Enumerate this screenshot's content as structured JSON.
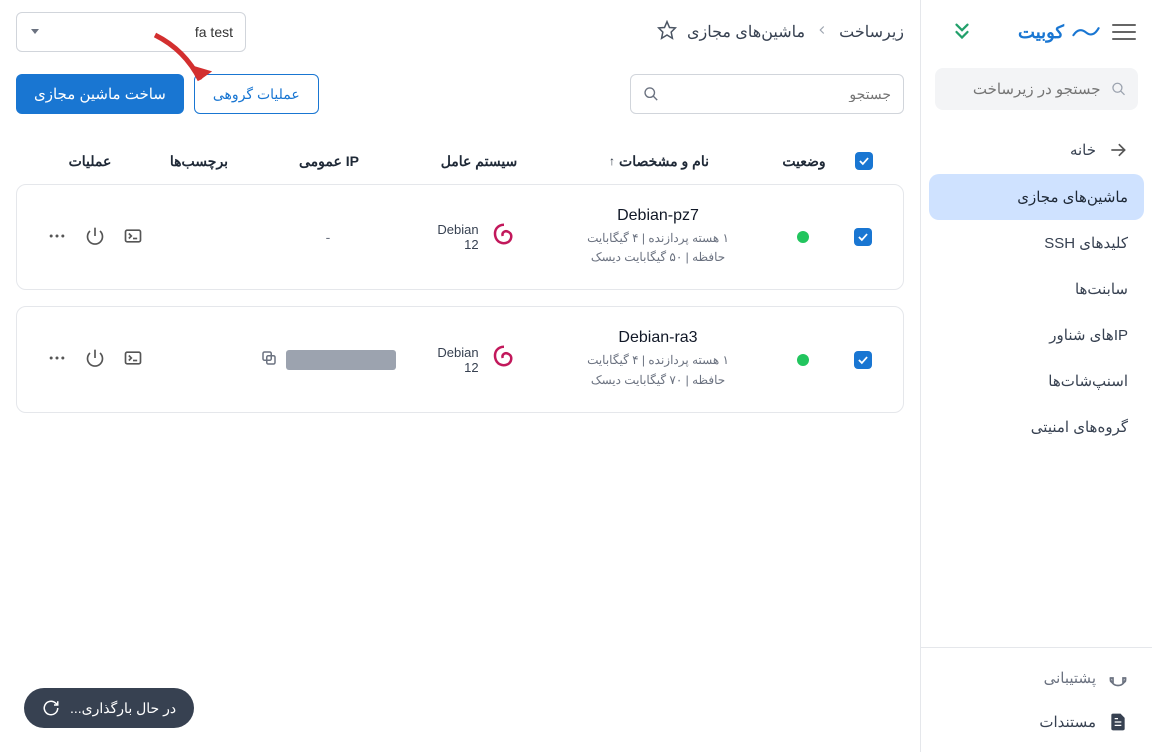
{
  "brand": {
    "name": "کوبیت"
  },
  "sidebar": {
    "search_placeholder": "جستجو در زیرساخت",
    "items": [
      {
        "label": "خانه",
        "icon": "arrow"
      },
      {
        "label": "ماشین‌های مجازی",
        "active": true
      },
      {
        "label": "کلیدهای SSH"
      },
      {
        "label": "سابنت‌ها"
      },
      {
        "label": "IPهای شناور"
      },
      {
        "label": "اسنپ‌شات‌ها"
      },
      {
        "label": "گروه‌های امنیتی"
      }
    ],
    "footer": [
      {
        "label": "پشتیبانی",
        "icon": "support"
      },
      {
        "label": "مستندات",
        "icon": "doc",
        "dark": true
      }
    ]
  },
  "breadcrumb": {
    "root": "زیرساخت",
    "current": "ماشین‌های مجازی"
  },
  "project": {
    "selected": "fa test"
  },
  "toolbar": {
    "search_placeholder": "جستجو",
    "group_ops": "عملیات گروهی",
    "create_vm": "ساخت ماشین مجازی"
  },
  "table": {
    "headers": {
      "status": "وضعیت",
      "name": "نام و مشخصات",
      "os": "سیستم عامل",
      "ip": "IP عمومی",
      "tags": "برچسب‌ها",
      "actions": "عملیات"
    },
    "rows": [
      {
        "name": "Debian-pz7",
        "spec1": "۱ هسته پردازنده | ۴ گیگابایت",
        "spec2": "حافظه | ۵۰ گیگابایت دیسک",
        "os_name": "Debian",
        "os_ver": "12",
        "ip": "-",
        "ip_hidden": false
      },
      {
        "name": "Debian-ra3",
        "spec1": "۱ هسته پردازنده | ۴ گیگابایت",
        "spec2": "حافظه | ۷۰ گیگابایت دیسک",
        "os_name": "Debian",
        "os_ver": "12",
        "ip": "",
        "ip_hidden": true
      }
    ]
  },
  "toast": {
    "text": "در حال بارگذاری..."
  }
}
